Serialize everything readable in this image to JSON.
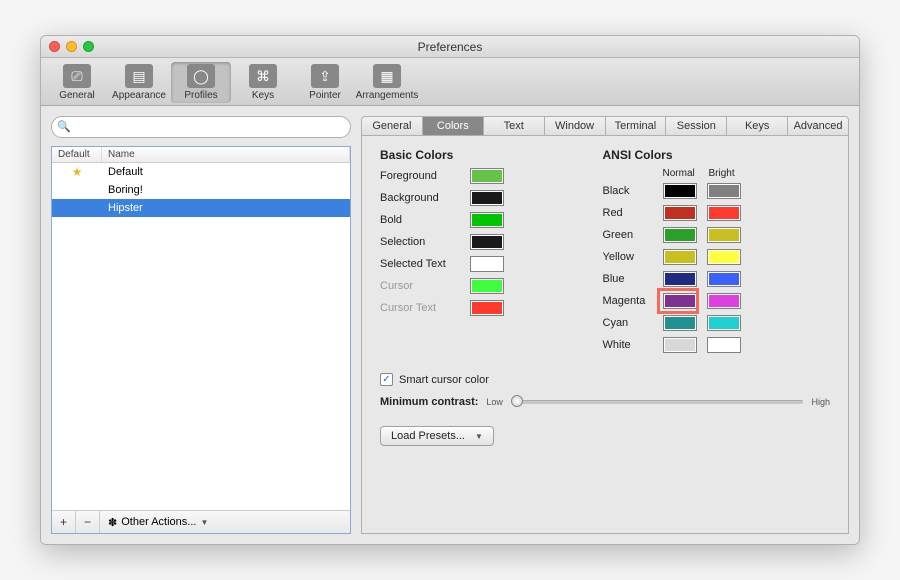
{
  "window": {
    "title": "Preferences"
  },
  "toolbar": [
    {
      "id": "general",
      "label": "General"
    },
    {
      "id": "appearance",
      "label": "Appearance"
    },
    {
      "id": "profiles",
      "label": "Profiles",
      "selected": true
    },
    {
      "id": "keys",
      "label": "Keys"
    },
    {
      "id": "pointer",
      "label": "Pointer"
    },
    {
      "id": "arrangements",
      "label": "Arrangements"
    }
  ],
  "search": {
    "placeholder": ""
  },
  "profile_list": {
    "columns": {
      "default": "Default",
      "name": "Name"
    },
    "rows": [
      {
        "name": "Default",
        "is_default": true,
        "selected": false
      },
      {
        "name": "Boring!",
        "is_default": false,
        "selected": false
      },
      {
        "name": "Hipster",
        "is_default": false,
        "selected": true
      }
    ],
    "footer": {
      "add": "+",
      "remove": "−",
      "actions_label": "Other Actions..."
    }
  },
  "tabs": [
    {
      "id": "general",
      "label": "General"
    },
    {
      "id": "colors",
      "label": "Colors",
      "active": true
    },
    {
      "id": "text",
      "label": "Text"
    },
    {
      "id": "window",
      "label": "Window"
    },
    {
      "id": "terminal",
      "label": "Terminal"
    },
    {
      "id": "session",
      "label": "Session"
    },
    {
      "id": "keys",
      "label": "Keys"
    },
    {
      "id": "advanced",
      "label": "Advanced"
    }
  ],
  "basic": {
    "title": "Basic Colors",
    "items": [
      {
        "label": "Foreground",
        "color": "#67c24a"
      },
      {
        "label": "Background",
        "color": "#1a1a1a"
      },
      {
        "label": "Bold",
        "color": "#00c400"
      },
      {
        "label": "Selection",
        "color": "#1a1a1a"
      },
      {
        "label": "Selected Text",
        "color": "#ffffff"
      },
      {
        "label": "Cursor",
        "color": "#3dff3d",
        "dim": true
      },
      {
        "label": "Cursor Text",
        "color": "#ff3b30",
        "dim": true
      }
    ]
  },
  "ansi": {
    "title": "ANSI Colors",
    "head_normal": "Normal",
    "head_bright": "Bright",
    "rows": [
      {
        "label": "Black",
        "normal": "#000000",
        "bright": "#808080"
      },
      {
        "label": "Red",
        "normal": "#c03020",
        "bright": "#ff3b30"
      },
      {
        "label": "Green",
        "normal": "#2aa02a",
        "bright": "#c8c020"
      },
      {
        "label": "Yellow",
        "normal": "#c8c020",
        "bright": "#ffff40"
      },
      {
        "label": "Blue",
        "normal": "#202a80",
        "bright": "#3a60ff"
      },
      {
        "label": "Magenta",
        "normal": "#803090",
        "bright": "#e040e0",
        "highlighted": true
      },
      {
        "label": "Cyan",
        "normal": "#209090",
        "bright": "#20d0d0"
      },
      {
        "label": "White",
        "normal": "#d8d8d8",
        "bright": "#ffffff"
      }
    ]
  },
  "smart_cursor": {
    "label": "Smart cursor color",
    "checked": true
  },
  "contrast": {
    "label": "Minimum contrast:",
    "low": "Low",
    "high": "High",
    "value": 0
  },
  "load_presets": {
    "label": "Load Presets..."
  }
}
